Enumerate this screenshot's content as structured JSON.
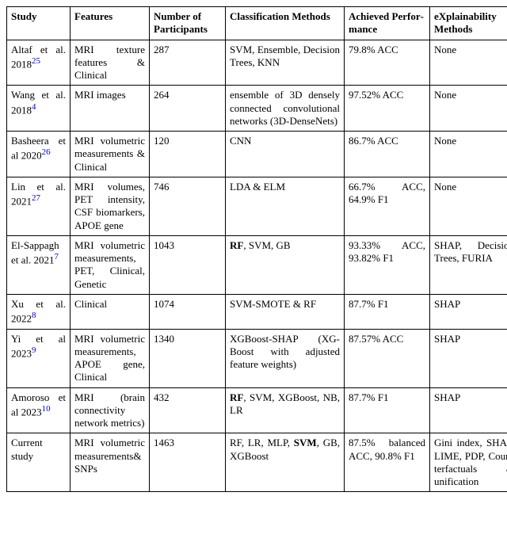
{
  "headers": {
    "study": "Study",
    "features": "Features",
    "num": "Number of Participants",
    "class": "Classification Meth­ods",
    "perf": "Achieved Perfor­mance",
    "xai": "eXplainability Methods"
  },
  "rows": [
    {
      "study_pre": "Altaf et al. 2018",
      "ref": "25",
      "features": "MRI texture features & Clinical",
      "num": "287",
      "class": "SVM, Ensemble, Deci­sion Trees, KNN",
      "perf": "79.8% ACC",
      "xai": "None"
    },
    {
      "study_pre": "Wang et al. 2018",
      "ref": "4",
      "features": "MRI images",
      "num": "264",
      "class": "ensemble of 3D densely connected con­volutional networks (3D-DenseNets)",
      "perf": "97.52% ACC",
      "xai": "None"
    },
    {
      "study_pre": "Basheera et al 2020",
      "ref": "26",
      "features": "MRI volu­metric mea­surements & Clinical",
      "num": "120",
      "class": "CNN",
      "perf": "86.7% ACC",
      "xai": "None"
    },
    {
      "study_pre": "Lin et al. 2021",
      "ref": "27",
      "features": "MRI volumes, PET intensity, CSF biomark­ers, APOE gene",
      "num": "746",
      "class": "LDA & ELM",
      "perf": "66.7% ACC, 64.9% F1",
      "xai": "None"
    },
    {
      "study_pre": "El-Sappagh et al. 2021",
      "ref": "7",
      "features": "MRI volu­metric mea­surements, PET, Clinical, Genetic",
      "num": "1043",
      "class_pre": "",
      "class_bold": "RF",
      "class_post": ", SVM, GB",
      "perf": "93.33% ACC, 93.82% F1",
      "xai": "SHAP, De­cision Trees, FURIA"
    },
    {
      "study_pre": "Xu et al. 2022",
      "ref": "8",
      "features": "Clinical",
      "num": "1074",
      "class": "SVM-SMOTE & RF",
      "perf": "87.7% F1",
      "xai": "SHAP"
    },
    {
      "study_pre": "Yi et al 2023",
      "ref": "9",
      "features": "MRI vol­umetric measure­ments, APOE gene, Clinical",
      "num": "1340",
      "class": "XGBoost-SHAP (XG­Boost with adjusted feature weights)",
      "perf": "87.57% ACC",
      "xai": "SHAP"
    },
    {
      "study_pre": "Amoroso et al 2023",
      "ref": "10",
      "features": "MRI (brain connectivity network met­rics)",
      "num": "432",
      "class_pre": "",
      "class_bold": "RF",
      "class_post": ", SVM, XGBoost, NB, LR",
      "perf": "87.7% F1",
      "xai": "SHAP"
    },
    {
      "study_pre": "Current study",
      "ref": "",
      "features": "MRI vol­umetric measure­ments& SNPs",
      "num": "1463",
      "class_pre": "RF, LR, MLP, ",
      "class_bold": "SVM",
      "class_post": ", GB, XGBoost",
      "perf": "87.5% balanced ACC, 90.8% F1",
      "xai": "Gini index, SHAP, LIME, PDP, Coun­terfactuals & unification"
    }
  ]
}
